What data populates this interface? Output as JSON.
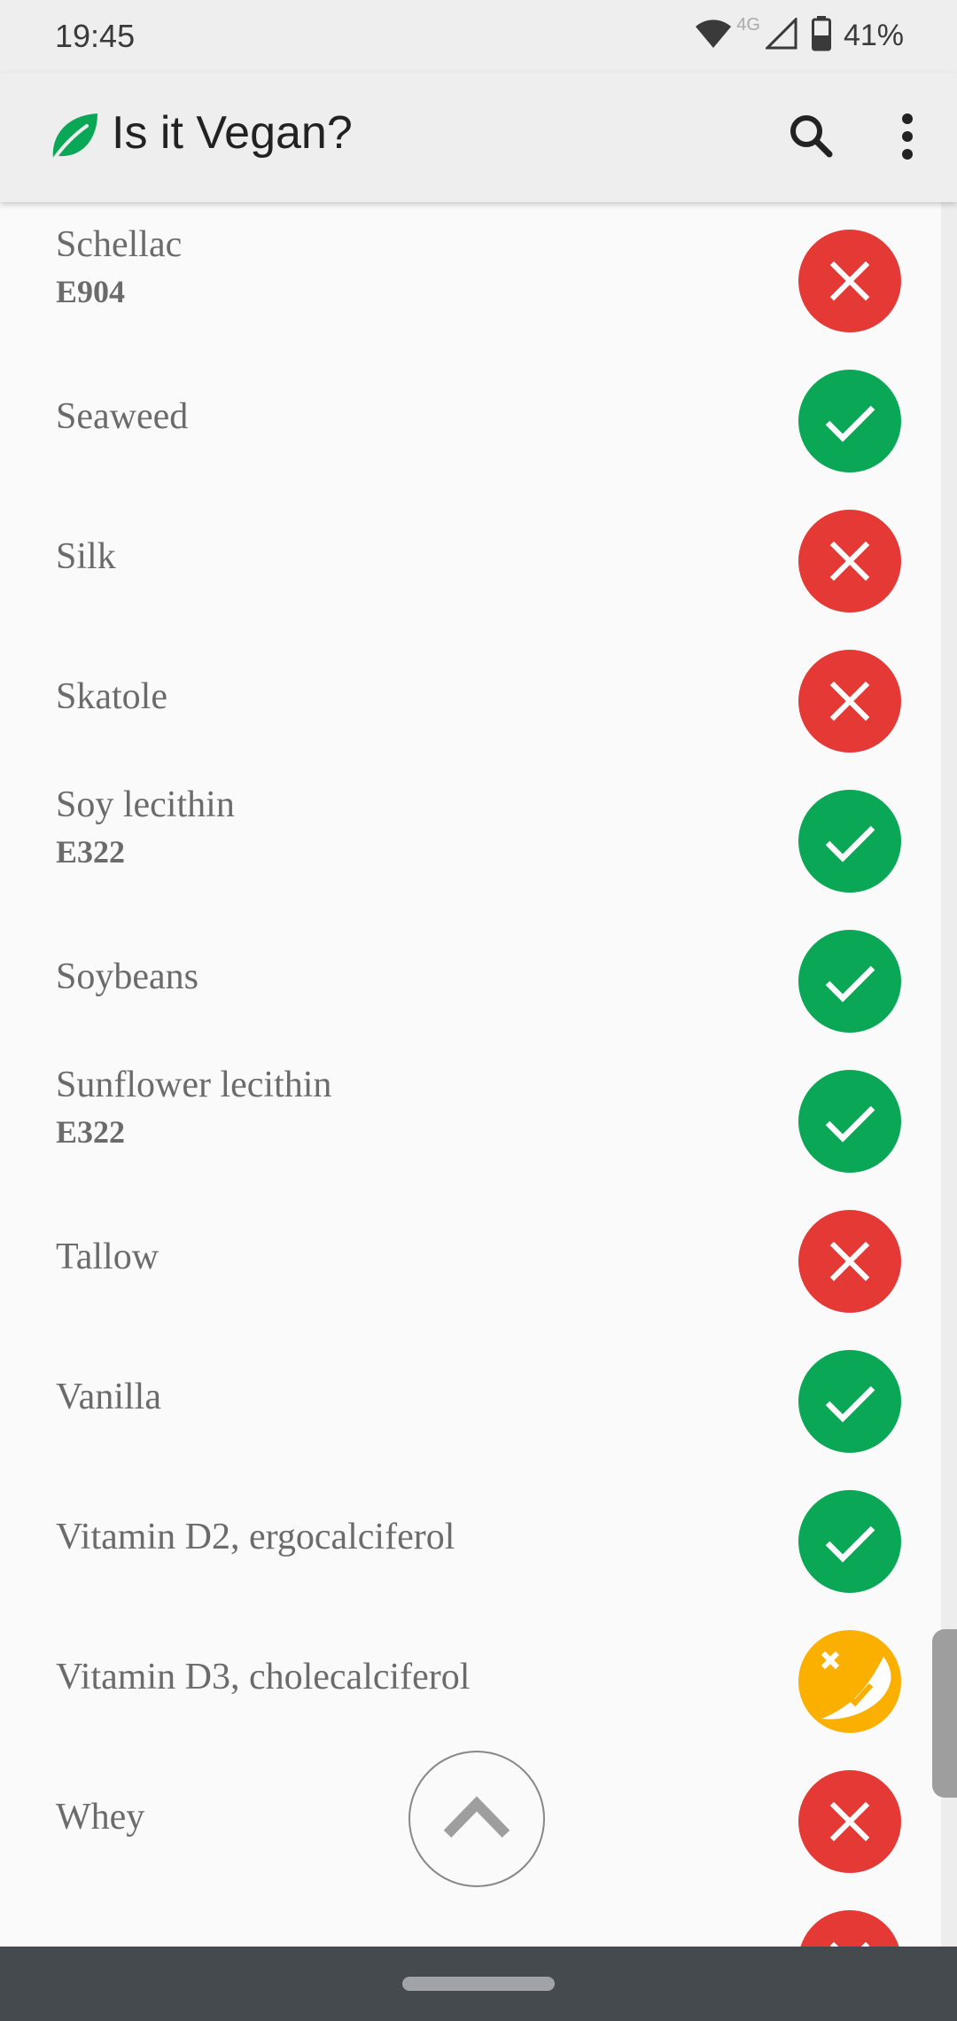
{
  "status_bar": {
    "time": "19:45",
    "network": "4G",
    "battery": "41%",
    "icons": [
      "wifi-icon",
      "signal-icon",
      "battery-icon"
    ]
  },
  "app_bar": {
    "title": "Is it Vegan?",
    "logo_icon": "leaf-icon",
    "actions": [
      "search-icon",
      "more-vert-icon"
    ]
  },
  "colors": {
    "vegan": "#0aa757",
    "not_vegan": "#e53935",
    "maybe": "#fbb000"
  },
  "ingredients": [
    {
      "name": "Schellac",
      "ecode": "E904",
      "status": "not_vegan"
    },
    {
      "name": "Seaweed",
      "ecode": "",
      "status": "vegan"
    },
    {
      "name": "Silk",
      "ecode": "",
      "status": "not_vegan"
    },
    {
      "name": "Skatole",
      "ecode": "",
      "status": "not_vegan"
    },
    {
      "name": "Soy lecithin",
      "ecode": "E322",
      "status": "vegan"
    },
    {
      "name": "Soybeans",
      "ecode": "",
      "status": "vegan"
    },
    {
      "name": "Sunflower lecithin",
      "ecode": "E322",
      "status": "vegan"
    },
    {
      "name": "Tallow",
      "ecode": "",
      "status": "not_vegan"
    },
    {
      "name": "Vanilla",
      "ecode": "",
      "status": "vegan"
    },
    {
      "name": "Vitamin D2, ergocalciferol",
      "ecode": "",
      "status": "vegan"
    },
    {
      "name": "Vitamin D3, cholecalciferol",
      "ecode": "",
      "status": "maybe"
    },
    {
      "name": "Whey",
      "ecode": "",
      "status": "not_vegan"
    },
    {
      "name": "",
      "ecode": "",
      "status": "not_vegan"
    }
  ],
  "fab": {
    "icon": "chevron-up-icon"
  },
  "nav": {
    "handle": "gesture-handle"
  }
}
